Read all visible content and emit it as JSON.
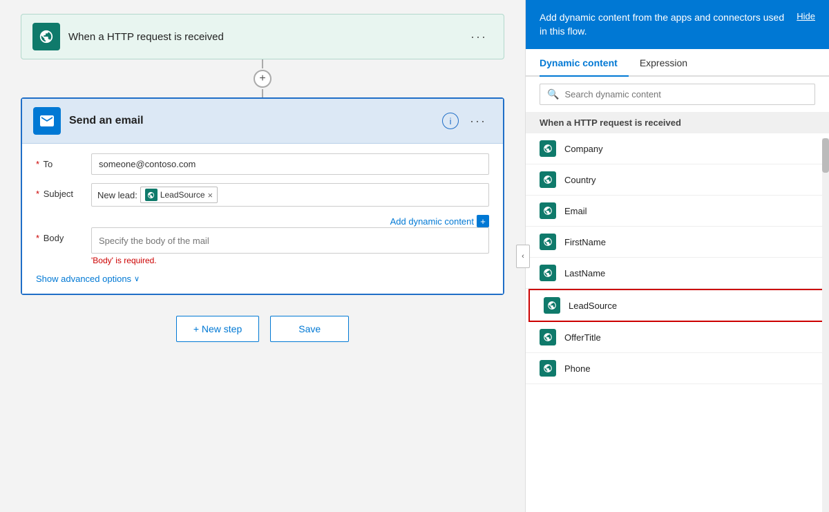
{
  "http_block": {
    "title": "When a HTTP request is received",
    "menu_label": "···"
  },
  "connector": {
    "add_label": "+"
  },
  "email_block": {
    "title": "Send an email",
    "to_label": "* To",
    "to_value": "someone@contoso.com",
    "to_placeholder": "someone@contoso.com",
    "subject_label": "* Subject",
    "subject_text": "New lead:",
    "subject_tag": "LeadSource",
    "body_label": "* Body",
    "body_placeholder": "Specify the body of the mail",
    "body_error": "'Body' is required.",
    "add_dynamic_label": "Add dynamic content",
    "show_advanced_label": "Show advanced options",
    "info_label": "i",
    "menu_label": "···"
  },
  "actions": {
    "new_step_label": "+ New step",
    "save_label": "Save"
  },
  "right_panel": {
    "header_text": "Add dynamic content from the apps and connectors used in this flow.",
    "hide_label": "Hide",
    "tab_dynamic": "Dynamic content",
    "tab_expression": "Expression",
    "search_placeholder": "Search dynamic content",
    "section_title": "When a HTTP request is received",
    "items": [
      {
        "label": "Company",
        "selected": false
      },
      {
        "label": "Country",
        "selected": false
      },
      {
        "label": "Email",
        "selected": false
      },
      {
        "label": "FirstName",
        "selected": false
      },
      {
        "label": "LastName",
        "selected": false
      },
      {
        "label": "LeadSource",
        "selected": true
      },
      {
        "label": "OfferTitle",
        "selected": false
      },
      {
        "label": "Phone",
        "selected": false
      }
    ]
  }
}
